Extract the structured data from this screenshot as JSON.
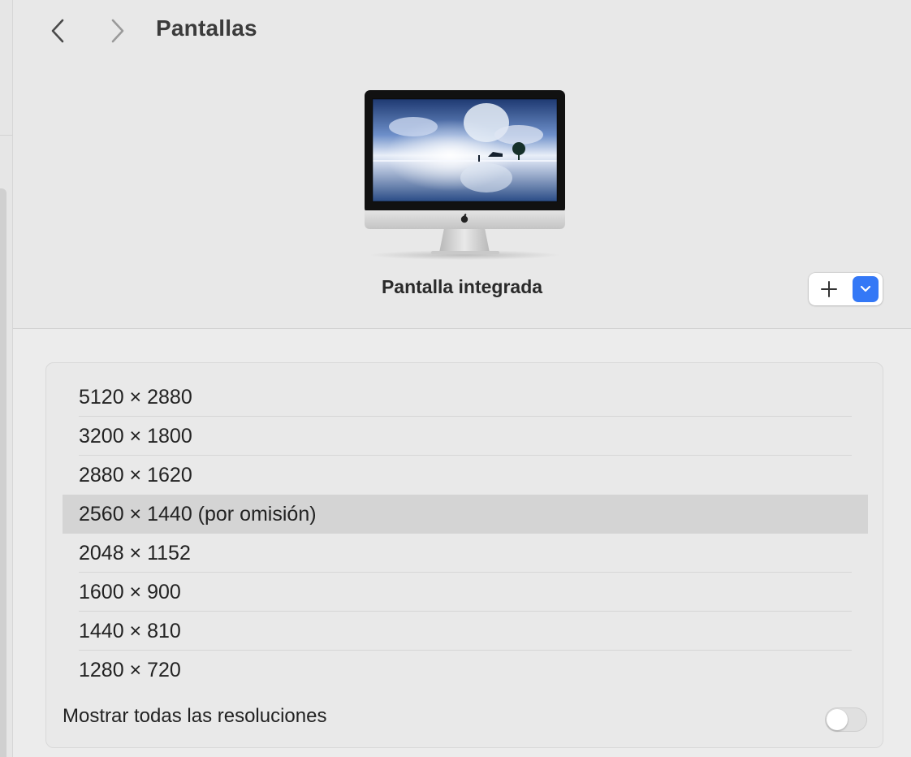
{
  "header": {
    "title": "Pantallas",
    "back_icon": "chevron-left-icon",
    "forward_icon": "chevron-right-icon"
  },
  "display": {
    "name": "Pantalla integrada",
    "add_icon": "plus-icon",
    "dropdown_icon": "chevron-down-icon",
    "accent_color": "#3478f6"
  },
  "resolutions": {
    "items": [
      {
        "label": "5120 × 2880"
      },
      {
        "label": "3200 × 1800"
      },
      {
        "label": "2880 × 1620"
      },
      {
        "label": "2560 × 1440 (por omisión)"
      },
      {
        "label": "2048 × 1152"
      },
      {
        "label": "1600 × 900"
      },
      {
        "label": "1440 × 810"
      },
      {
        "label": "1280 × 720"
      }
    ],
    "selected_index": 3,
    "show_all_label": "Mostrar todas las resoluciones",
    "show_all_enabled": false
  }
}
